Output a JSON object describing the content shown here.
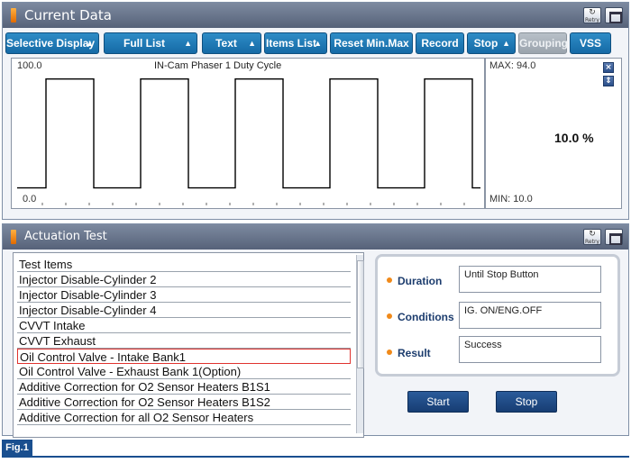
{
  "current_data": {
    "title": "Current Data",
    "retry_label": "Retry",
    "toolbar": {
      "selective_display": "Selective Display",
      "full_list": "Full List",
      "text": "Text",
      "items_list": "Items List",
      "reset_min_max": "Reset Min.Max",
      "record": "Record",
      "stop": "Stop",
      "grouping": "Grouping",
      "vss": "VSS"
    },
    "graph": {
      "title": "IN-Cam Phaser 1 Duty Cycle",
      "y_max_label": "100.0",
      "y_min_label": "0.0",
      "max_label": "MAX: 94.0",
      "min_label": "MIN: 10.0",
      "current_value": "10.0 %",
      "signal_high": 94.0,
      "signal_low": 10.0,
      "periods": 5
    }
  },
  "actuation_test": {
    "title": "Actuation Test",
    "retry_label": "Retry",
    "list_header": "Test Items",
    "items": [
      "Injector Disable-Cylinder 2",
      "Injector Disable-Cylinder 3",
      "Injector Disable-Cylinder 4",
      "CVVT Intake",
      "CVVT Exhaust",
      "Oil Control Valve - Intake Bank1",
      "Oil Control Valve - Exhaust Bank 1(Option)",
      "Additive Correction for O2 Sensor Heaters B1S1",
      "Additive Correction for O2 Sensor Heaters B1S2",
      "Additive Correction for all O2 Sensor Heaters"
    ],
    "selected_index": 5,
    "duration_label": "Duration",
    "duration_value": "Until Stop Button",
    "conditions_label": "Conditions",
    "conditions_value": "IG. ON/ENG.OFF",
    "result_label": "Result",
    "result_value": "Success",
    "start_label": "Start",
    "stop_label": "Stop"
  },
  "figure_label": "Fig.1",
  "colors": {
    "accent": "#1a6fb0",
    "title_bar": "#5e6b82",
    "selected_border": "#e0332f",
    "signal": "#000000"
  }
}
